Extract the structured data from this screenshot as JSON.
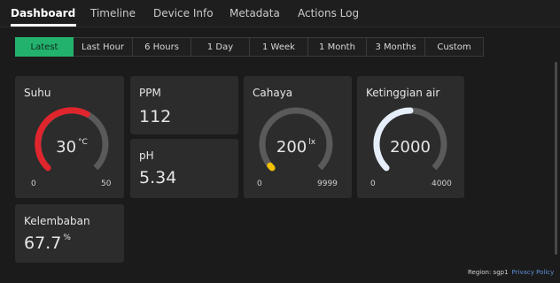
{
  "nav": {
    "tabs": [
      {
        "label": "Dashboard"
      },
      {
        "label": "Timeline"
      },
      {
        "label": "Device Info"
      },
      {
        "label": "Metadata"
      },
      {
        "label": "Actions Log"
      }
    ]
  },
  "ranges": [
    "Latest",
    "Last Hour",
    "6 Hours",
    "1 Day",
    "1 Week",
    "1 Month",
    "3 Months",
    "Custom"
  ],
  "widgets": {
    "suhu": {
      "title": "Suhu",
      "value": "30",
      "unit": "°C",
      "min": "0",
      "max": "50",
      "level": 0.6
    },
    "ppm": {
      "title": "PPM",
      "value": "112"
    },
    "ph": {
      "title": "pH",
      "value": "5.34"
    },
    "cahaya": {
      "title": "Cahaya",
      "value": "200",
      "unit": "lx",
      "min": "0",
      "max": "9999",
      "level": 0.02
    },
    "ketinggian": {
      "title": "Ketinggian air",
      "value": "2000",
      "unit": "",
      "min": "0",
      "max": "4000",
      "level": 0.5
    },
    "kelembaban": {
      "title": "Kelembaban",
      "value": "67.7",
      "unit": "%"
    }
  },
  "colors": {
    "accent": "#23b26d",
    "suhu": "#e0252d",
    "cahaya": "#f2c100",
    "ketinggian": "#e5eef9",
    "track": "#5a5a5a"
  },
  "footer": {
    "region": "Region: sgp1",
    "privacy": "Privacy Policy"
  }
}
